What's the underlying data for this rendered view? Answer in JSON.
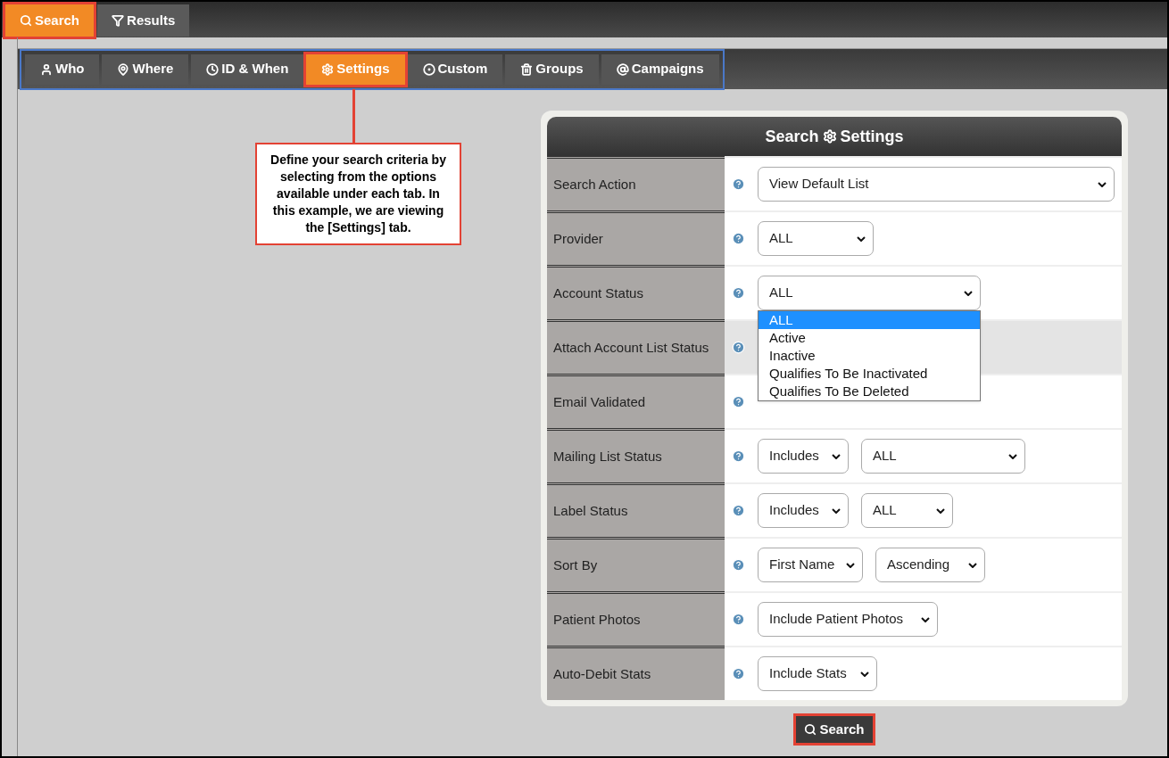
{
  "top_tabs": [
    {
      "label": "Search",
      "selected": true
    },
    {
      "label": "Results",
      "selected": false
    }
  ],
  "tabs": [
    {
      "label": "Who",
      "selected": false
    },
    {
      "label": "Where",
      "selected": false
    },
    {
      "label": "ID & When",
      "selected": false
    },
    {
      "label": "Settings",
      "selected": true
    },
    {
      "label": "Custom",
      "selected": false
    },
    {
      "label": "Groups",
      "selected": false
    },
    {
      "label": "Campaigns",
      "selected": false
    }
  ],
  "callout": {
    "text": "Define your search criteria by selecting from the options available under each tab. In this example, we are viewing the [Settings] tab."
  },
  "panel": {
    "title_before": "Search",
    "title_after": "Settings",
    "rows": [
      {
        "label": "Search Action",
        "highlighted": false,
        "fields": [
          {
            "value": "View Default List"
          }
        ]
      },
      {
        "label": "Provider",
        "highlighted": false,
        "fields": [
          {
            "value": "ALL"
          }
        ]
      },
      {
        "label": "Account Status",
        "highlighted": false,
        "fields": [
          {
            "value": "ALL",
            "open": true,
            "options": [
              {
                "label": "ALL",
                "selected": true
              },
              {
                "label": "Active",
                "selected": false
              },
              {
                "label": "Inactive",
                "selected": false
              },
              {
                "label": "Qualifies To Be Inactivated",
                "selected": false
              },
              {
                "label": "Qualifies To Be Deleted",
                "selected": false
              }
            ]
          }
        ]
      },
      {
        "label": "Attach Account List Status",
        "highlighted": true,
        "fields": []
      },
      {
        "label": "Email Validated",
        "highlighted": false,
        "fields": []
      },
      {
        "label": "Mailing List Status",
        "highlighted": false,
        "fields": [
          {
            "value": "Includes"
          },
          {
            "value": "ALL"
          }
        ]
      },
      {
        "label": "Label Status",
        "highlighted": false,
        "fields": [
          {
            "value": "Includes"
          },
          {
            "value": "ALL"
          }
        ]
      },
      {
        "label": "Sort By",
        "highlighted": false,
        "fields": [
          {
            "value": "First Name"
          },
          {
            "value": "Ascending"
          }
        ]
      },
      {
        "label": "Patient Photos",
        "highlighted": false,
        "fields": [
          {
            "value": "Include Patient Photos"
          }
        ]
      },
      {
        "label": "Auto-Debit Stats",
        "highlighted": false,
        "fields": [
          {
            "value": "Include Stats"
          }
        ]
      }
    ]
  },
  "search_button": {
    "label": "Search"
  }
}
